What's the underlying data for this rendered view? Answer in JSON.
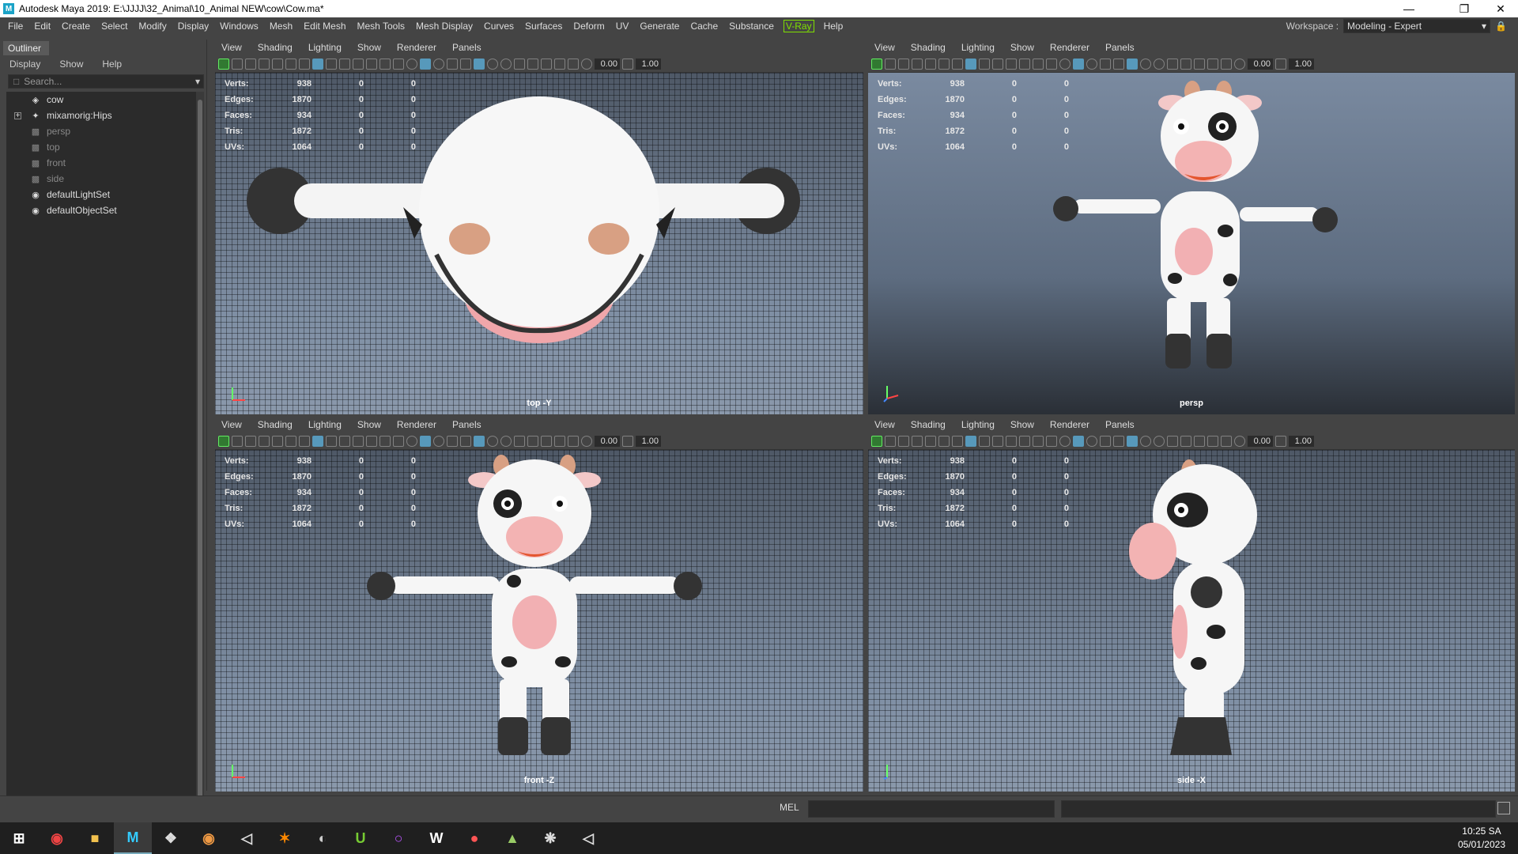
{
  "window": {
    "title": "Autodesk Maya 2019: E:\\JJJJ\\32_Animal\\10_Animal NEW\\cow\\Cow.ma*",
    "icon": "maya-app-icon",
    "controls": [
      "minimize-icon",
      "restore-icon",
      "close-icon"
    ]
  },
  "menubar": {
    "items": [
      "File",
      "Edit",
      "Create",
      "Select",
      "Modify",
      "Display",
      "Windows",
      "Mesh",
      "Edit Mesh",
      "Mesh Tools",
      "Mesh Display",
      "Curves",
      "Surfaces",
      "Deform",
      "UV",
      "Generate",
      "Cache",
      "Substance",
      "V-Ray",
      "Help"
    ]
  },
  "workspace": {
    "label": "Workspace :",
    "value": "Modeling - Expert"
  },
  "outliner": {
    "tab": "Outliner",
    "menu": [
      "Display",
      "Show",
      "Help"
    ],
    "search_placeholder": "Search...",
    "items": [
      {
        "label": "cow",
        "icon": "transform-icon",
        "dim": false
      },
      {
        "label": "mixamorig:Hips",
        "icon": "joint-icon",
        "dim": false,
        "expandable": true
      },
      {
        "label": "persp",
        "icon": "camera-icon",
        "dim": true
      },
      {
        "label": "top",
        "icon": "camera-icon",
        "dim": true
      },
      {
        "label": "front",
        "icon": "camera-icon",
        "dim": true
      },
      {
        "label": "side",
        "icon": "camera-icon",
        "dim": true
      },
      {
        "label": "defaultLightSet",
        "icon": "set-icon",
        "dim": false
      },
      {
        "label": "defaultObjectSet",
        "icon": "set-icon",
        "dim": false
      }
    ]
  },
  "viewport_menu": [
    "View",
    "Shading",
    "Lighting",
    "Show",
    "Renderer",
    "Panels"
  ],
  "toolbar_values": {
    "exposure": "0.00",
    "gamma": "1.00"
  },
  "hud": [
    {
      "label": "Verts:",
      "value": "938",
      "c1": "0",
      "c2": "0"
    },
    {
      "label": "Edges:",
      "value": "1870",
      "c1": "0",
      "c2": "0"
    },
    {
      "label": "Faces:",
      "value": "934",
      "c1": "0",
      "c2": "0"
    },
    {
      "label": "Tris:",
      "value": "1872",
      "c1": "0",
      "c2": "0"
    },
    {
      "label": "UVs:",
      "value": "1064",
      "c1": "0",
      "c2": "0"
    }
  ],
  "viewports": [
    {
      "name": "top",
      "label": "top -Y"
    },
    {
      "name": "persp",
      "label": "persp"
    },
    {
      "name": "front",
      "label": "front -Z"
    },
    {
      "name": "side",
      "label": "side -X"
    }
  ],
  "commandline": {
    "mode": "MEL"
  },
  "taskbar": {
    "clock_time": "10:25 SA",
    "clock_date": "05/01/2023"
  }
}
